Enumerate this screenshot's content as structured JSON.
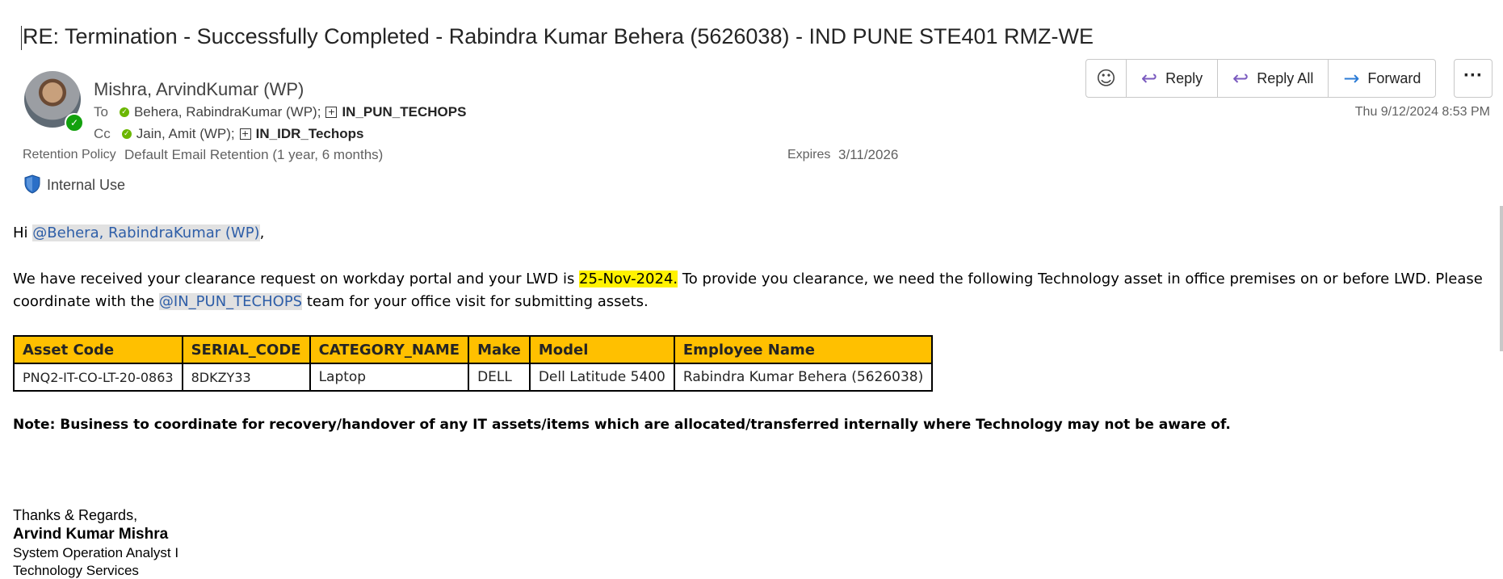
{
  "email": {
    "subject": "RE: Termination - Successfully Completed - Rabindra Kumar Behera (5626038) - IND PUNE STE401 RMZ-WE",
    "sender": "Mishra, ArvindKumar (WP)",
    "to_label": "To",
    "to_person": "Behera, RabindraKumar (WP);",
    "to_group": "IN_PUN_TECHOPS",
    "cc_label": "Cc",
    "cc_person": "Jain, Amit (WP);",
    "cc_group": "IN_IDR_Techops",
    "retention_label": "Retention Policy",
    "retention_value": "Default Email Retention (1 year, 6 months)",
    "expires_label": "Expires",
    "expires_value": "3/11/2026",
    "sensitivity": "Internal Use",
    "date": "Thu 9/12/2024 8:53 PM"
  },
  "toolbar": {
    "reply": "Reply",
    "reply_all": "Reply All",
    "forward": "Forward",
    "more": "···"
  },
  "body": {
    "greeting_prefix": "Hi ",
    "greeting_mention": "@Behera, RabindraKumar (WP)",
    "greeting_suffix": ",",
    "para1_a": "We have received your clearance request on workday portal and your LWD is ",
    "para1_lwd": "25-Nov-2024.",
    "para1_b": " To provide you clearance, we need the following Technology asset in office premises on or before LWD. Please",
    "para1_c": "coordinate with the ",
    "para1_mention": "@IN_PUN_TECHOPS",
    "para1_d": " team for your office visit for submitting assets.",
    "table_headers": [
      "Asset Code",
      "SERIAL_CODE",
      "CATEGORY_NAME",
      "Make",
      "Model",
      "Employee Name"
    ],
    "table_row": [
      "PNQ2-IT-CO-LT-20-0863",
      "8DKZY33",
      "Laptop",
      "DELL",
      "Dell Latitude 5400",
      "Rabindra Kumar Behera (5626038)"
    ],
    "note": "Note: Business to coordinate for recovery/handover of any IT assets/items which are allocated/transferred internally where Technology may not be aware of.",
    "regards": "Thanks & Regards,",
    "sig_name": "Arvind Kumar Mishra",
    "sig_title": "System Operation Analyst I",
    "sig_dept": "Technology Services"
  },
  "colors": {
    "table_header_bg": "#ffc000",
    "highlight": "#fff200",
    "mention_text": "#2e5ea8",
    "presence": "#13a10e"
  }
}
